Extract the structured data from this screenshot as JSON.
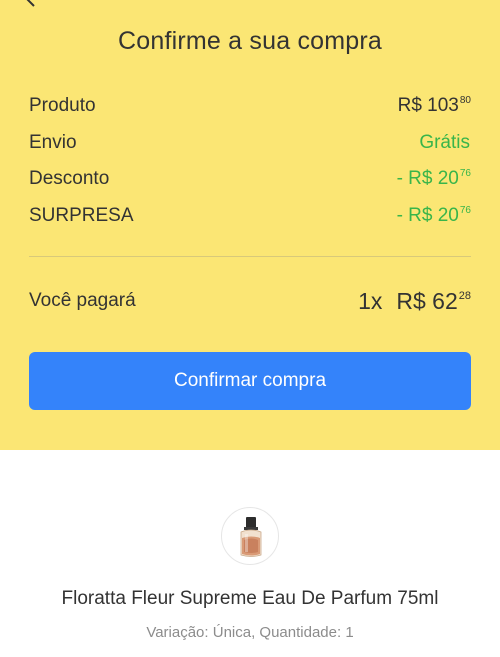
{
  "header": {
    "title": "Confirme a sua compra"
  },
  "summary": {
    "rows": [
      {
        "label": "Produto",
        "prefix": "",
        "value": "R$ 103",
        "cents": "80",
        "color": "#333333"
      },
      {
        "label": "Envio",
        "prefix": "",
        "value": "Grátis",
        "cents": "",
        "color": "#39b54a"
      },
      {
        "label": "Desconto",
        "prefix": "- ",
        "value": "R$ 20",
        "cents": "76",
        "color": "#39b54a"
      },
      {
        "label": "SURPRESA",
        "prefix": "- ",
        "value": "R$ 20",
        "cents": "76",
        "color": "#39b54a"
      }
    ]
  },
  "total": {
    "label": "Você pagará",
    "quantity": "1x",
    "value": "R$ 62",
    "cents": "28"
  },
  "actions": {
    "confirm_label": "Confirmar compra"
  },
  "product": {
    "icon": "perfume-bottle-image",
    "name": "Floratta Fleur Supreme Eau De Parfum 75ml",
    "meta": "Variação: Única, Quantidade: 1"
  },
  "colors": {
    "accent": "#3483fa",
    "header_bg": "#fbe674",
    "discount": "#39b54a"
  }
}
